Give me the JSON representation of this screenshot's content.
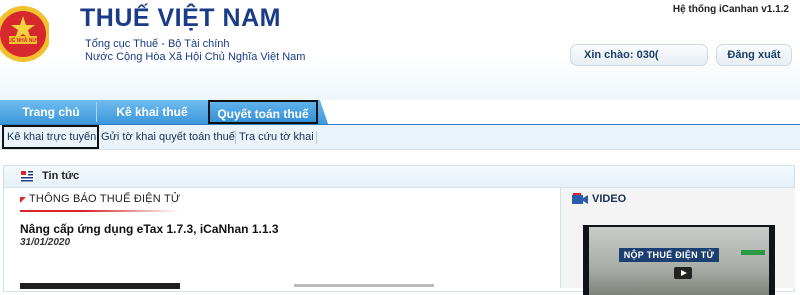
{
  "header": {
    "title": "THUẾ VIỆT NAM",
    "line1": "Tổng cục Thuế - Bộ Tài chính",
    "line2": "Nước Cộng Hòa Xã Hội Chủ Nghĩa Việt Nam",
    "system_name": "Hệ thống iCanhan v1.1.2",
    "emblem_text": "THUẾ NHÀ NƯỚC",
    "greeting_label": "Xin chào:",
    "greeting_user": "030(",
    "logout_label": "Đăng xuất"
  },
  "nav": {
    "tabs": [
      {
        "label": "Trang chủ"
      },
      {
        "label": "Kê khai thuế"
      },
      {
        "label": "Quyết toán thuế"
      }
    ]
  },
  "subnav": {
    "items": [
      {
        "label": "Kê khai trực tuyến"
      },
      {
        "label": "Gửi tờ khai quyết toán thuế"
      },
      {
        "label": "Tra cứu tờ khai"
      }
    ]
  },
  "news": {
    "section_title": "Tin tức",
    "notice_title": "THÔNG BÁO THUẾ ĐIỆN TỬ",
    "article_title": "Nâng cấp ứng dụng eTax 1.7.3, iCaNhan 1.1.3",
    "article_date": "31/01/2020"
  },
  "video": {
    "section_title": "VIDEO",
    "sign_text": "NỘP THUẾ ĐIỆN TỬ"
  },
  "colors": {
    "brand": "#1a3b87",
    "nav": "#3d97da",
    "accent_red": "#d8252b"
  }
}
